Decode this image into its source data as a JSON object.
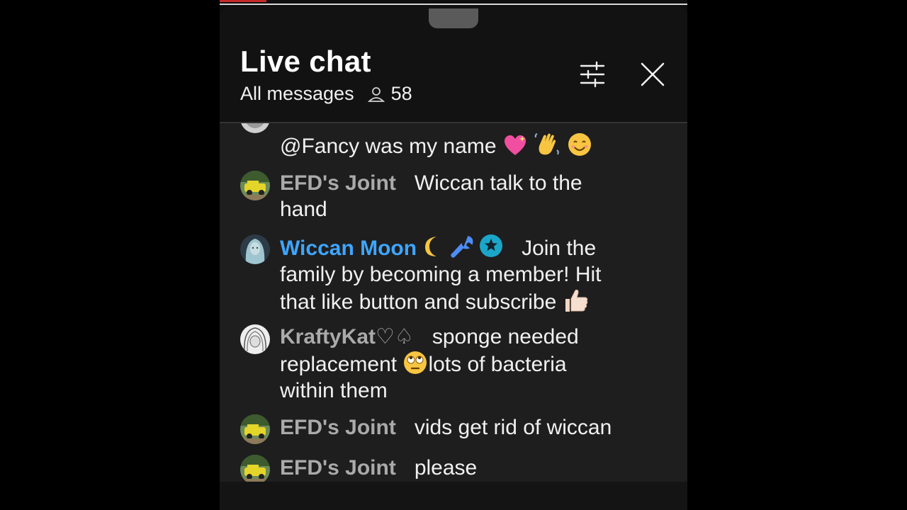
{
  "header": {
    "title": "Live chat",
    "filter_label": "All messages",
    "viewer_count": "58"
  },
  "icons": {
    "settings": "tune-sliders-icon",
    "close": "close-icon",
    "viewers": "person-icon"
  },
  "colors": {
    "member_author": "#3ea6ff",
    "author": "#aaaaaa",
    "text": "#f1f1f1",
    "background": "#1e1e1e"
  },
  "messages": [
    {
      "author": "",
      "text": "@Fancy was my name",
      "emojis": [
        "sparkling-heart",
        "waving-hand",
        "smiling-face"
      ]
    },
    {
      "author": "EFD's Joint",
      "text_line1": "Wiccan talk to the",
      "text_line2": "hand"
    },
    {
      "author": "Wiccan Moon",
      "badges": [
        "crescent-moon",
        "wrench",
        "star-verified"
      ],
      "text_line1": "Join the",
      "text_line2": "family by becoming a member! Hit",
      "text_line3": "that like button and subscribe",
      "emojis": [
        "thumbs-up"
      ]
    },
    {
      "author": "KraftyKat♡♤",
      "text_line1": "sponge needed",
      "text_line2a": "replacement",
      "text_line2b": "lots of bacteria",
      "text_line3": "within them",
      "emojis": [
        "eye-roll-face"
      ]
    },
    {
      "author": "EFD's Joint",
      "text": "vids get rid of wiccan"
    },
    {
      "author": "EFD's Joint",
      "text": "please"
    }
  ]
}
